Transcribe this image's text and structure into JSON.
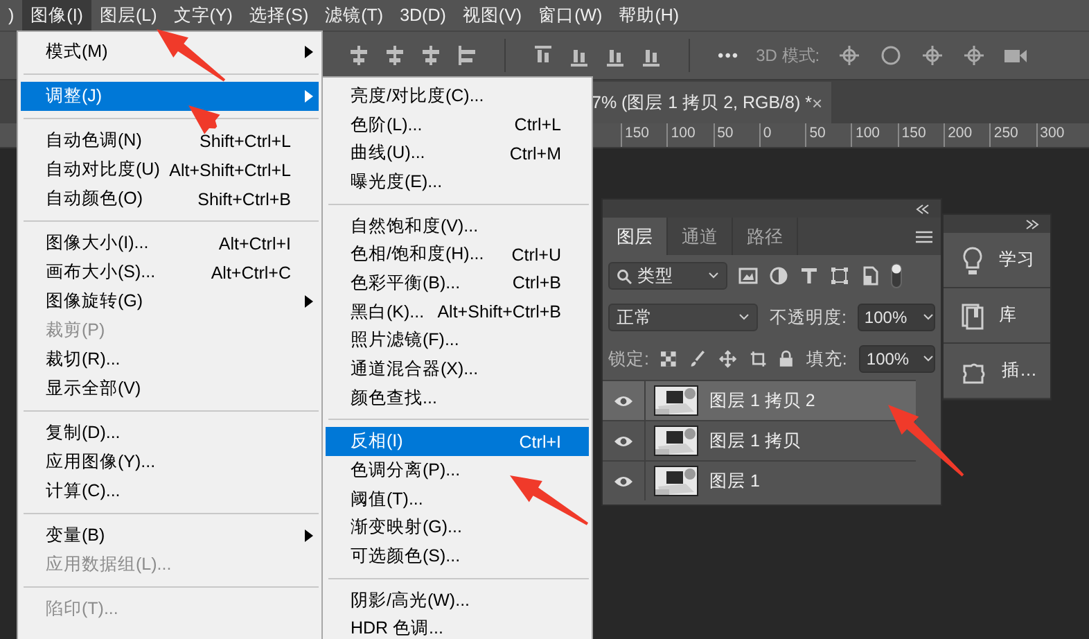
{
  "menu_bar": [
    {
      "label": ")",
      "selected": false
    },
    {
      "label": "图像(I)",
      "selected": true
    },
    {
      "label": "图层(L)",
      "selected": false
    },
    {
      "label": "文字(Y)",
      "selected": false
    },
    {
      "label": "选择(S)",
      "selected": false
    },
    {
      "label": "滤镜(T)",
      "selected": false
    },
    {
      "label": "3D(D)",
      "selected": false
    },
    {
      "label": "视图(V)",
      "selected": false
    },
    {
      "label": "窗口(W)",
      "selected": false
    },
    {
      "label": "帮助(H)",
      "selected": false
    }
  ],
  "options_bar": {
    "more": "•••",
    "mode_label": "3D 模式:"
  },
  "document_tab": {
    "title": "7% (图层 1 拷贝 2, RGB/8) *",
    "close": "×"
  },
  "ruler": [
    "150",
    "100",
    "50",
    "0",
    "50",
    "100",
    "150",
    "200",
    "250",
    "300"
  ],
  "image_menu": {
    "groups": [
      [
        {
          "label": "模式(M)",
          "submenu": true,
          "disabled": false,
          "selected": false
        }
      ],
      [
        {
          "label": "调整(J)",
          "submenu": true,
          "disabled": false,
          "selected": true
        }
      ],
      [
        {
          "label": "自动色调(N)",
          "shortcut": "Shift+Ctrl+L",
          "submenu": false,
          "disabled": false,
          "selected": false
        },
        {
          "label": "自动对比度(U)",
          "shortcut": "Alt+Shift+Ctrl+L",
          "submenu": false,
          "disabled": false,
          "selected": false
        },
        {
          "label": "自动颜色(O)",
          "shortcut": "Shift+Ctrl+B",
          "submenu": false,
          "disabled": false,
          "selected": false
        }
      ],
      [
        {
          "label": "图像大小(I)...",
          "shortcut": "Alt+Ctrl+I",
          "submenu": false,
          "disabled": false,
          "selected": false
        },
        {
          "label": "画布大小(S)...",
          "shortcut": "Alt+Ctrl+C",
          "submenu": false,
          "disabled": false,
          "selected": false
        },
        {
          "label": "图像旋转(G)",
          "submenu": true,
          "disabled": false,
          "selected": false
        },
        {
          "label": "裁剪(P)",
          "submenu": false,
          "disabled": true,
          "selected": false
        },
        {
          "label": "裁切(R)...",
          "submenu": false,
          "disabled": false,
          "selected": false
        },
        {
          "label": "显示全部(V)",
          "submenu": false,
          "disabled": false,
          "selected": false
        }
      ],
      [
        {
          "label": "复制(D)...",
          "submenu": false,
          "disabled": false,
          "selected": false
        },
        {
          "label": "应用图像(Y)...",
          "submenu": false,
          "disabled": false,
          "selected": false
        },
        {
          "label": "计算(C)...",
          "submenu": false,
          "disabled": false,
          "selected": false
        }
      ],
      [
        {
          "label": "变量(B)",
          "submenu": true,
          "disabled": false,
          "selected": false
        },
        {
          "label": "应用数据组(L)...",
          "submenu": false,
          "disabled": true,
          "selected": false
        }
      ],
      [
        {
          "label": "陷印(T)...",
          "submenu": false,
          "disabled": true,
          "selected": false
        }
      ]
    ]
  },
  "adjust_menu": {
    "groups": [
      [
        {
          "label": "亮度/对比度(C)...",
          "selected": false
        },
        {
          "label": "色阶(L)...",
          "shortcut": "Ctrl+L",
          "selected": false
        },
        {
          "label": "曲线(U)...",
          "shortcut": "Ctrl+M",
          "selected": false
        },
        {
          "label": "曝光度(E)...",
          "selected": false
        }
      ],
      [
        {
          "label": "自然饱和度(V)...",
          "selected": false
        },
        {
          "label": "色相/饱和度(H)...",
          "shortcut": "Ctrl+U",
          "selected": false
        },
        {
          "label": "色彩平衡(B)...",
          "shortcut": "Ctrl+B",
          "selected": false
        },
        {
          "label": "黑白(K)...",
          "shortcut": "Alt+Shift+Ctrl+B",
          "selected": false
        },
        {
          "label": "照片滤镜(F)...",
          "selected": false
        },
        {
          "label": "通道混合器(X)...",
          "selected": false
        },
        {
          "label": "颜色查找...",
          "selected": false
        }
      ],
      [
        {
          "label": "反相(I)",
          "shortcut": "Ctrl+I",
          "selected": true
        },
        {
          "label": "色调分离(P)...",
          "selected": false
        },
        {
          "label": "阈值(T)...",
          "selected": false
        },
        {
          "label": "渐变映射(G)...",
          "selected": false
        },
        {
          "label": "可选颜色(S)...",
          "selected": false
        }
      ],
      [
        {
          "label": "阴影/高光(W)...",
          "selected": false
        },
        {
          "label": "HDR 色调...",
          "selected": false
        }
      ]
    ]
  },
  "layers_panel": {
    "tabs": [
      {
        "label": "图层",
        "selected": true
      },
      {
        "label": "通道",
        "selected": false
      },
      {
        "label": "路径",
        "selected": false
      }
    ],
    "filter": "类型",
    "blend_mode": "正常",
    "opacity_label": "不透明度:",
    "opacity": "100%",
    "lock_label": "锁定:",
    "fill_label": "填充:",
    "fill": "100%",
    "layers": [
      {
        "name": "图层 1 拷贝 2",
        "visible": true,
        "selected": true
      },
      {
        "name": "图层 1 拷贝",
        "visible": true,
        "selected": false
      },
      {
        "name": "图层 1",
        "visible": true,
        "selected": false
      }
    ]
  },
  "side_panel": {
    "items": [
      {
        "label": "学习"
      },
      {
        "label": "库"
      },
      {
        "label": "插…"
      }
    ]
  }
}
